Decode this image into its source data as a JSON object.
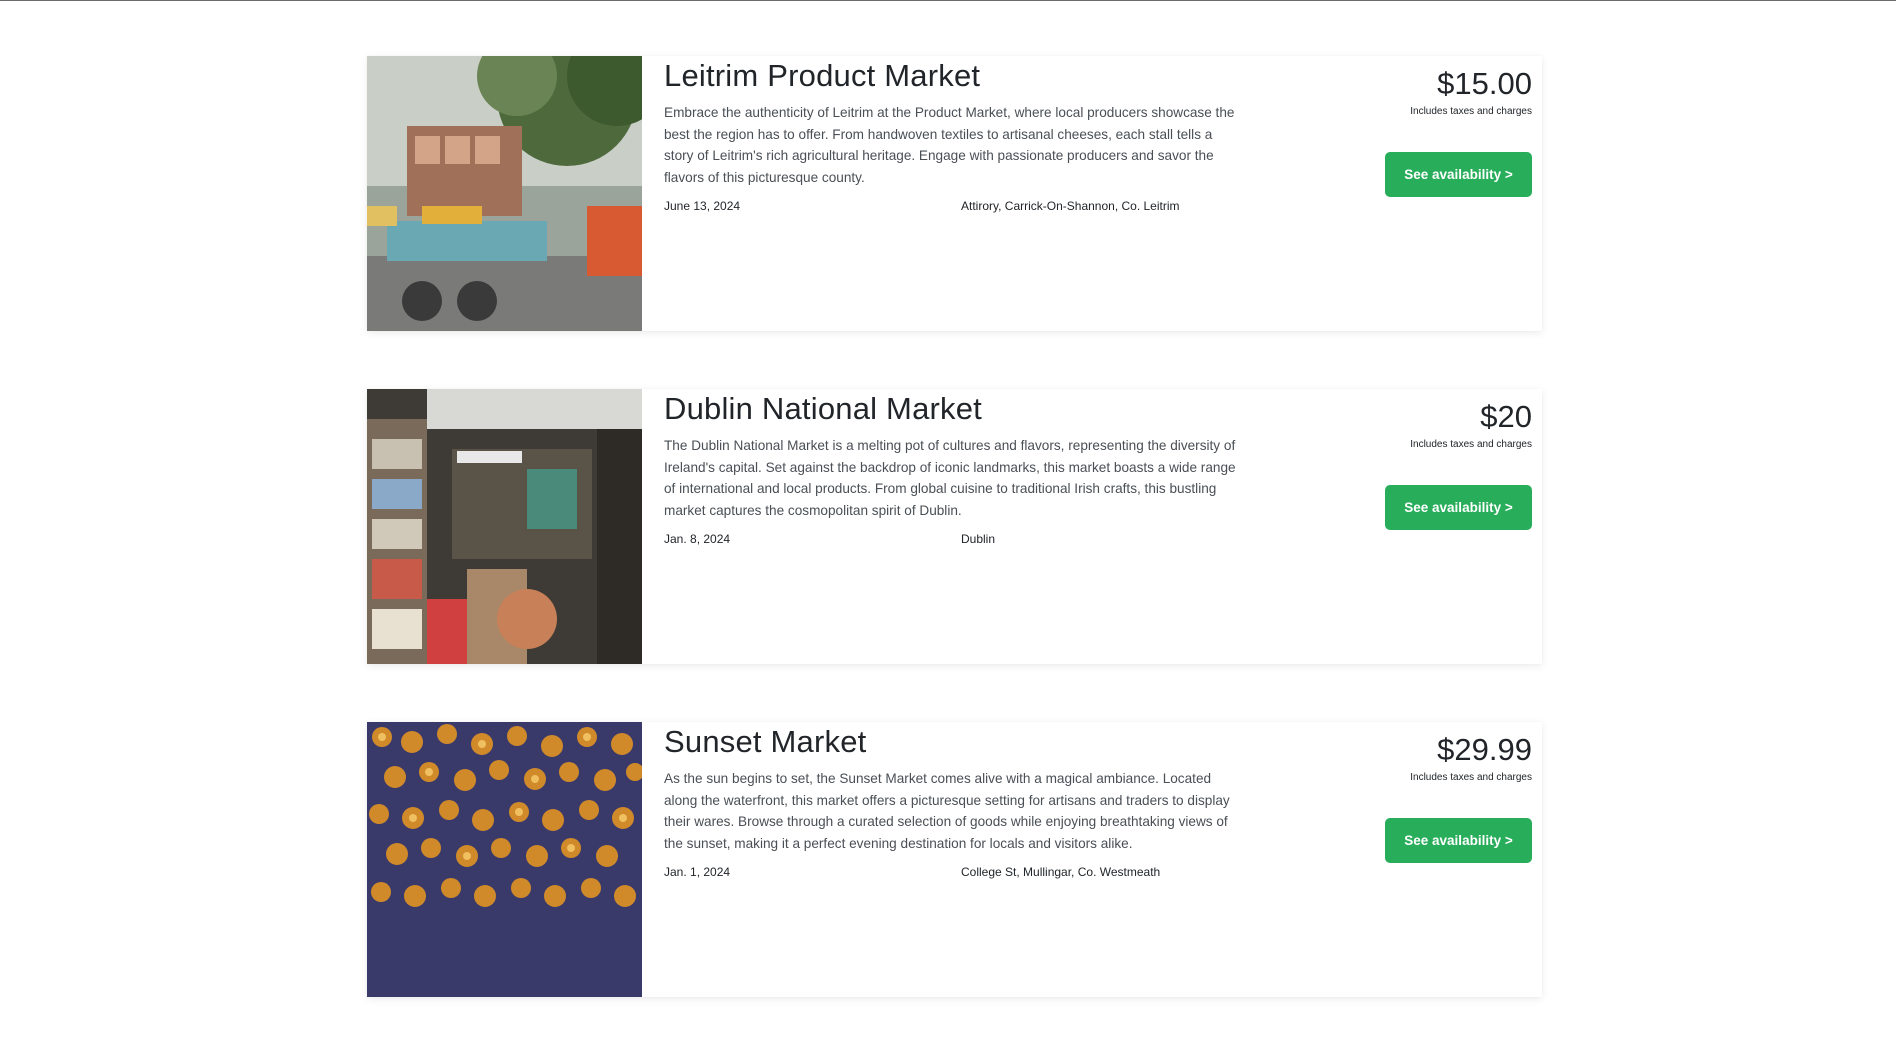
{
  "listings": [
    {
      "title": "Leitrim Product Market",
      "description": "Embrace the authenticity of Leitrim at the Product Market, where local producers showcase the best the region has to offer. From handwoven textiles to artisanal cheeses, each stall tells a story of Leitrim's rich agricultural heritage. Engage with passionate producers and savor the flavors of this picturesque county.",
      "date": "June 13, 2024",
      "location": "Attirory, Carrick-On-Shannon, Co. Leitrim",
      "price": "$15.00",
      "price_note": "Includes taxes and charges",
      "button_label": "See availability >"
    },
    {
      "title": "Dublin National Market",
      "description": "The Dublin National Market is a melting pot of cultures and flavors, representing the diversity of Ireland's capital. Set against the backdrop of iconic landmarks, this market boasts a wide range of international and local products. From global cuisine to traditional Irish crafts, this bustling market captures the cosmopolitan spirit of Dublin.",
      "date": "Jan. 8, 2024",
      "location": "Dublin",
      "price": "$20",
      "price_note": "Includes taxes and charges",
      "button_label": "See availability >"
    },
    {
      "title": "Sunset Market",
      "description": "As the sun begins to set, the Sunset Market comes alive with a magical ambiance. Located along the waterfront, this market offers a picturesque setting for artisans and traders to display their wares. Browse through a curated selection of goods while enjoying breathtaking views of the sunset, making it a perfect evening destination for locals and visitors alike.",
      "date": "Jan. 1, 2024",
      "location": "College St, Mullingar, Co. Westmeath",
      "price": "$29.99",
      "price_note": "Includes taxes and charges",
      "button_label": "See availability >"
    }
  ],
  "colors": {
    "button_bg": "#28ad5a",
    "button_text": "#ffffff",
    "text": "#212529",
    "muted_text": "#4a4f55"
  }
}
